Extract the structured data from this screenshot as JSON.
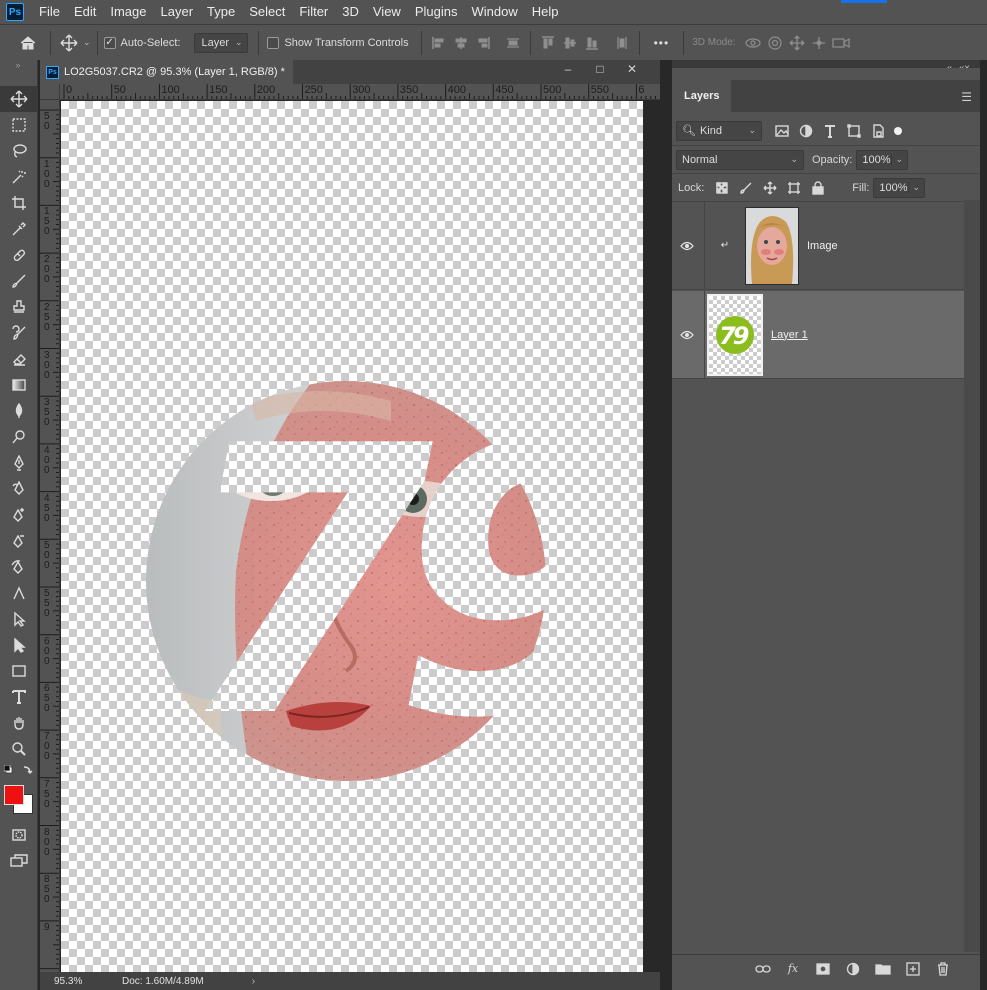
{
  "menubar": {
    "logo": "Ps",
    "items": [
      "File",
      "Edit",
      "Image",
      "Layer",
      "Type",
      "Select",
      "Filter",
      "3D",
      "View",
      "Plugins",
      "Window",
      "Help"
    ]
  },
  "options": {
    "auto_select_label": "Auto-Select:",
    "auto_select_value": "Layer",
    "show_transform_label": "Show Transform Controls",
    "more_label": "•••",
    "mode_3d_label": "3D Mode:"
  },
  "document": {
    "tab_title": "LO2G5037.CR2 @ 95.3% (Layer 1, RGB/8) *",
    "tab_icon": "Ps",
    "ruler_h": [
      "0",
      "50",
      "100",
      "150",
      "200",
      "250",
      "300",
      "350",
      "400",
      "450",
      "500",
      "550",
      "6"
    ],
    "ruler_v": [
      "5\n0",
      "1\n0\n0",
      "1\n5\n0",
      "2\n0\n0",
      "2\n5\n0",
      "3\n0\n0",
      "3\n5\n0",
      "4\n0\n0",
      "4\n5\n0",
      "5\n0\n0",
      "5\n5\n0",
      "6\n0\n0",
      "6\n5\n0",
      "7\n0\n0",
      "7\n5\n0",
      "8\n0\n0",
      "8\n5\n0",
      "9"
    ],
    "zoom": "95.3%",
    "doc_size": "Doc: 1.60M/4.89M",
    "status_arrow": "›",
    "clip_text": "79"
  },
  "toolbox": {
    "grip": "»",
    "foreground_color": "#ee1111",
    "background_color": "#ffffff"
  },
  "layers_panel": {
    "tab_label": "Layers",
    "filter_kind": "Kind",
    "blend_mode": "Normal",
    "opacity_label": "Opacity:",
    "opacity_value": "100%",
    "lock_label": "Lock:",
    "fill_label": "Fill:",
    "fill_value": "100%",
    "layers": [
      {
        "name": "Image",
        "visible": true,
        "clipped": true,
        "selected": false
      },
      {
        "name": "Layer 1",
        "visible": true,
        "clipped": false,
        "selected": true
      }
    ],
    "logo_text": "79",
    "logo_color": "#8bbd1f"
  },
  "colors": {
    "ui_bg": "#535353",
    "ui_dark": "#282828",
    "accent": "#1473e6"
  }
}
